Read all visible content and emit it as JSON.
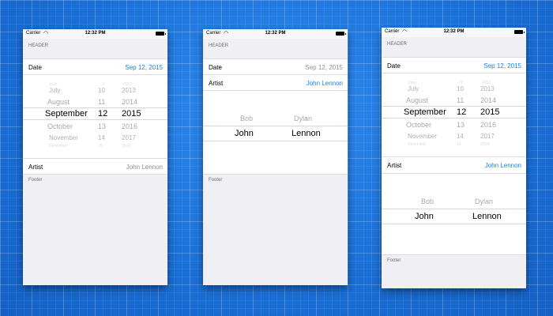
{
  "status": {
    "carrier": "Carrier",
    "time": "12:32 PM"
  },
  "table": {
    "header": "HEADER",
    "footer": "Footer",
    "date_label": "Date",
    "artist_label": "Artist"
  },
  "phone1": {
    "date_value": "Sep 12, 2015",
    "artist_value": "John Lennon"
  },
  "phone2": {
    "date_value": "Sep 12, 2015",
    "artist_value": "John Lennon"
  },
  "phone3": {
    "date_value": "Sep 12, 2015",
    "artist_value": "John Lennon"
  },
  "date_picker": {
    "months": [
      "June",
      "July",
      "August",
      "September",
      "October",
      "November",
      "December"
    ],
    "days": [
      "9",
      "10",
      "11",
      "12",
      "13",
      "14",
      "15"
    ],
    "years": [
      "2012",
      "2013",
      "2014",
      "2015",
      "2016",
      "2017",
      "2018"
    ]
  },
  "name_picker": {
    "first_unselected": "Bob",
    "last_unselected": "Dylan",
    "first_selected": "John",
    "last_selected": "Lennon"
  },
  "colors": {
    "accent": "#147efb",
    "background_blue": "#1f78e0",
    "table_bg": "#efeff4"
  }
}
